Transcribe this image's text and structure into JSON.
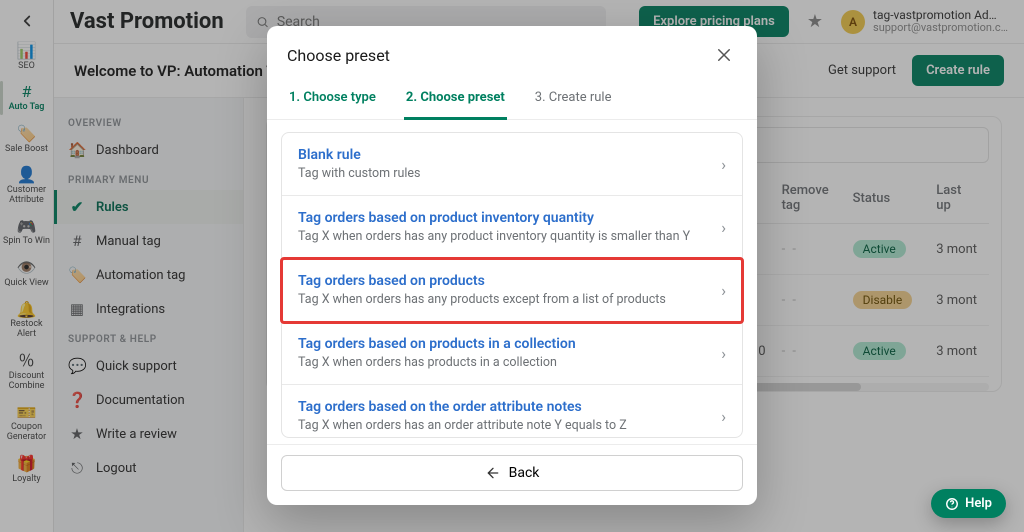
{
  "brand": "Vast Promotion",
  "search": {
    "placeholder": "Search"
  },
  "topbar": {
    "explore": "Explore pricing plans",
    "avatar_initial": "A",
    "user_name": "tag-vastpromotion Ad…",
    "user_mail": "support@vastpromotion.c…"
  },
  "subbar": {
    "welcome": "Welcome to VP: Automation Tags",
    "get_support": "Get support",
    "create_rule": "Create rule"
  },
  "rail": {
    "items": [
      {
        "label": "SEO"
      },
      {
        "label": "Auto Tag"
      },
      {
        "label": "Sale Boost"
      },
      {
        "label": "Customer Attribute"
      },
      {
        "label": "Spin To Win"
      },
      {
        "label": "Quick View"
      },
      {
        "label": "Restock Alert"
      },
      {
        "label": "Discount Combine"
      },
      {
        "label": "Coupon Generator"
      },
      {
        "label": "Loyalty"
      }
    ]
  },
  "sidebar": {
    "groups": {
      "overview": "OVERVIEW",
      "primary": "PRIMARY MENU",
      "support": "SUPPORT & HELP"
    },
    "items": {
      "dashboard": "Dashboard",
      "rules": "Rules",
      "manual_tag": "Manual tag",
      "automation_tag": "Automation tag",
      "integrations": "Integrations",
      "quick_support": "Quick support",
      "documentation": "Documentation",
      "write_review": "Write a review",
      "logout": "Logout"
    }
  },
  "table": {
    "headers": {
      "remove_tag": "Remove tag",
      "status": "Status",
      "updated": "Last up"
    },
    "rows": [
      {
        "remove": "- -",
        "status": "Active",
        "updated": "3 mont"
      },
      {
        "remove": "- -",
        "status": "Disable",
        "updated": "3 mont"
      },
      {
        "remove": "- -",
        "status": "Active",
        "updated": "3 mont"
      }
    ],
    "extra_cell": "0"
  },
  "modal": {
    "title": "Choose preset",
    "steps": {
      "s1": "1. Choose type",
      "s2": "2. Choose preset",
      "s3": "3. Create rule"
    },
    "presets": [
      {
        "title": "Blank rule",
        "desc": "Tag with custom rules"
      },
      {
        "title": "Tag orders based on product inventory quantity",
        "desc": "Tag X when orders has any product inventory quantity is smaller than Y"
      },
      {
        "title": "Tag orders based on products",
        "desc": "Tag X when orders has any products except from a list of products"
      },
      {
        "title": "Tag orders based on products in a collection",
        "desc": "Tag X when orders has products in a collection"
      },
      {
        "title": "Tag orders based on the order attribute notes",
        "desc": "Tag X when orders has an order attribute note Y equals to Z"
      }
    ],
    "back": "Back"
  },
  "help": "Help"
}
